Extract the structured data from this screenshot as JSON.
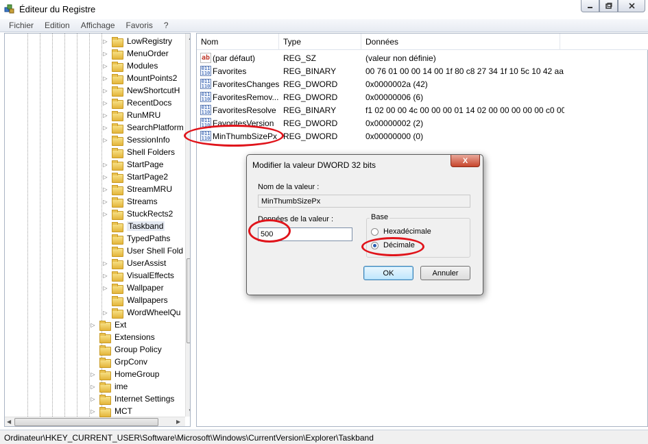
{
  "window": {
    "title": "Éditeur du Registre"
  },
  "menu": [
    "Fichier",
    "Edition",
    "Affichage",
    "Favoris",
    "?"
  ],
  "tree": {
    "sub_items": [
      "LowRegistry",
      "MenuOrder",
      "Modules",
      "MountPoints2",
      "NewShortcutH",
      "RecentDocs",
      "RunMRU",
      "SearchPlatform",
      "SessionInfo",
      "Shell Folders",
      "StartPage",
      "StartPage2",
      "StreamMRU",
      "Streams",
      "StuckRects2",
      "Taskband",
      "TypedPaths",
      "User Shell Fold",
      "UserAssist",
      "VisualEffects",
      "Wallpaper",
      "Wallpapers",
      "WordWheelQu"
    ],
    "top_items": [
      "Ext",
      "Extensions",
      "Group Policy",
      "GrpConv",
      "HomeGroup",
      "ime",
      "Internet Settings",
      "MCT"
    ],
    "selected": "Taskband"
  },
  "list": {
    "headers": {
      "name": "Nom",
      "type": "Type",
      "data": "Données"
    },
    "rows": [
      {
        "name": "(par défaut)",
        "type": "REG_SZ",
        "data": "(valeur non définie)",
        "icon": "string-value-icon"
      },
      {
        "name": "Favorites",
        "type": "REG_BINARY",
        "data": "00 76 01 00 00 14 00 1f 80 c8 27 34 1f 10 5c 10 42 aa ...",
        "icon": "binary-value-icon"
      },
      {
        "name": "FavoritesChanges",
        "type": "REG_DWORD",
        "data": "0x0000002a (42)",
        "icon": "binary-value-icon"
      },
      {
        "name": "FavoritesRemov...",
        "type": "REG_DWORD",
        "data": "0x00000006 (6)",
        "icon": "binary-value-icon"
      },
      {
        "name": "FavoritesResolve",
        "type": "REG_BINARY",
        "data": "f1 02 00 00 4c 00 00 00 01 14 02 00 00 00 00 00 c0 00...",
        "icon": "binary-value-icon"
      },
      {
        "name": "FavoritesVersion",
        "type": "REG_DWORD",
        "data": "0x00000002 (2)",
        "icon": "binary-value-icon"
      },
      {
        "name": "MinThumbSizePx",
        "type": "REG_DWORD",
        "data": "0x00000000 (0)",
        "icon": "binary-value-icon"
      }
    ]
  },
  "dialog": {
    "title": "Modifier la valeur DWORD 32 bits",
    "close": "X",
    "name_label": "Nom de la valeur :",
    "name_value": "MinThumbSizePx",
    "data_label": "Données de la valeur :",
    "data_value": "500",
    "base_label": "Base",
    "radio_hex": "Hexadécimale",
    "radio_dec": "Décimale",
    "selected_base": "Décimale",
    "ok": "OK",
    "cancel": "Annuler"
  },
  "status": "Ordinateur\\HKEY_CURRENT_USER\\Software\\Microsoft\\Windows\\CurrentVersion\\Explorer\\Taskband",
  "colors": {
    "annotation": "#e0141b",
    "selection": "#e4e9f2"
  }
}
